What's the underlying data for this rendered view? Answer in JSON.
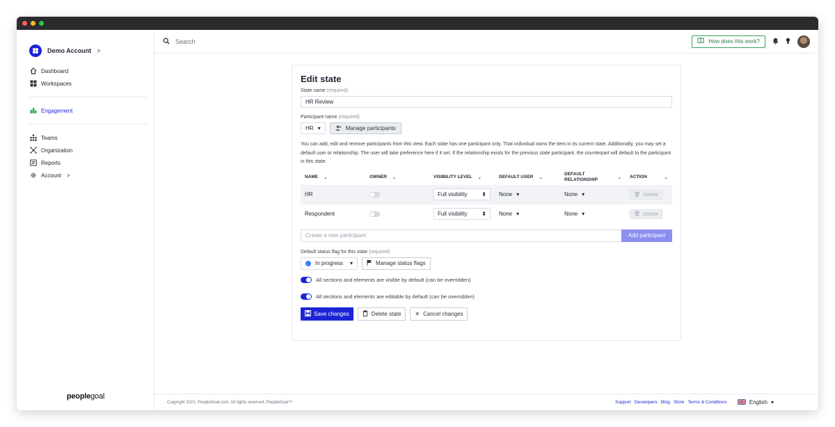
{
  "window": {
    "dots": [
      "#ff5f57",
      "#febc2e",
      "#28c840"
    ]
  },
  "account": {
    "name": "Demo Account",
    "chevron": ">"
  },
  "sidebar": {
    "group1": [
      {
        "label": "Dashboard",
        "icon": "home-icon"
      },
      {
        "label": "Workspaces",
        "icon": "grid-icon"
      }
    ],
    "engagement": {
      "label": "Engagement",
      "icon": "engagement-icon"
    },
    "group3": [
      {
        "label": "Teams",
        "icon": "teams-icon"
      },
      {
        "label": "Organization",
        "icon": "organization-icon"
      },
      {
        "label": "Reports",
        "icon": "reports-icon"
      },
      {
        "label": "Account",
        "icon": "gear-icon",
        "chevron": ">"
      }
    ],
    "brand_bold": "people",
    "brand_light": "goal"
  },
  "topbar": {
    "search_placeholder": "Search",
    "how_label": "How does this work?"
  },
  "form": {
    "title": "Edit state",
    "state_name_label": "State name",
    "required": "(required)",
    "state_name_value": "HR Review",
    "participant_label": "Participant name",
    "participant_value": "HR",
    "manage_participants": "Manage participants",
    "help_text": "You can add, edit and remove participants from this view. Each state has one participant only. That individual owns the item in its current state. Additionally, you may set a default user or relationship. The user will take preference here if it set. If the relationship exists for the previous state participant, the counterpart will default to the participant in this state.",
    "table": {
      "headers": [
        "NAME",
        "OWNER",
        "VISIBILITY LEVEL",
        "DEFAULT USER",
        "DEFAULT RELATIONSHIP",
        "ACTION"
      ],
      "rows": [
        {
          "name": "HR",
          "visibility": "Full visibility",
          "default_user": "None",
          "default_relationship": "None",
          "action": "Delete"
        },
        {
          "name": "Respondent",
          "visibility": "Full visibility",
          "default_user": "None",
          "default_relationship": "None",
          "action": "Delete"
        }
      ]
    },
    "new_participant_placeholder": "Create a new participant",
    "add_participant": "Add participant",
    "status_flag_label": "Default status flag for this state",
    "status_value": "In progress",
    "status_color": "#3b82f6",
    "manage_status_flags": "Manage status flags",
    "toggle_visible": "All sections and elements are visible by default (can be overridden)",
    "toggle_editable": "All sections and elements are editable by default (can be overridden)",
    "save": "Save changes",
    "delete_state": "Delete state",
    "cancel": "Cancel changes"
  },
  "footer": {
    "copyright": "Copyright 2021, PeopleGoal.com. All rights reserved, PeopleGoal™",
    "links": [
      "Support",
      "Developers",
      "Blog",
      "Store",
      "Terms & Conditions"
    ],
    "language": "English"
  },
  "colors": {
    "accent": "#1c25d6",
    "help_border": "#3aa05a"
  }
}
